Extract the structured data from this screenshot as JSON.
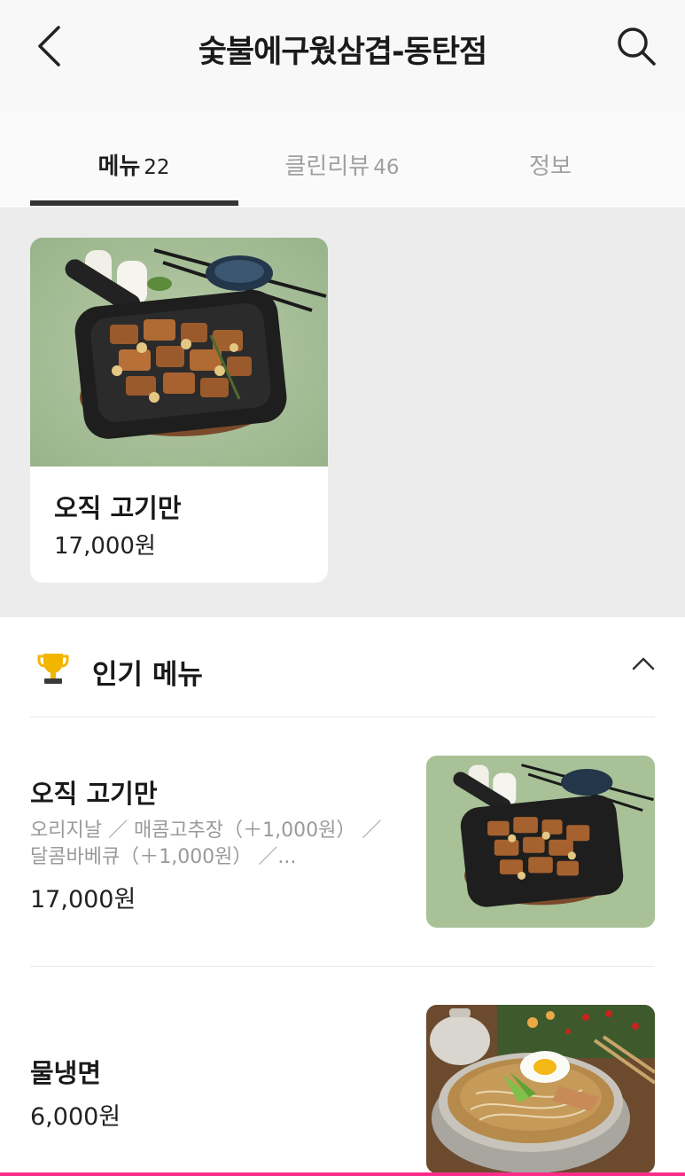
{
  "header": {
    "title": "숯불에구웠삼겹-동탄점",
    "back_icon": "chevron-left-icon",
    "search_icon": "search-icon"
  },
  "tabs": [
    {
      "label": "메뉴",
      "count": "22",
      "active": true
    },
    {
      "label": "클린리뷰",
      "count": "46",
      "active": false
    },
    {
      "label": "정보",
      "count": "",
      "active": false
    }
  ],
  "featured": {
    "name": "오직 고기만",
    "price": "17,000원",
    "image_icon": "pork-skillet-photo"
  },
  "popular": {
    "title": "인기 메뉴",
    "icon": "trophy-icon",
    "collapse_icon": "chevron-up-icon",
    "items": [
      {
        "name": "오직 고기만",
        "description": "오리지날 ／ 매콤고추장（＋1,000원） ／ 달콤바베큐（＋1,000원） ／...",
        "price": "17,000원",
        "image_icon": "pork-skillet-photo"
      },
      {
        "name": "물냉면",
        "description": "",
        "price": "6,000원",
        "image_icon": "cold-noodle-photo"
      }
    ]
  },
  "colors": {
    "accent_bar": "#ff2d8a",
    "trophy": "#f2b600",
    "tab_indicator": "#333333",
    "featured_bg": "#ececec"
  }
}
